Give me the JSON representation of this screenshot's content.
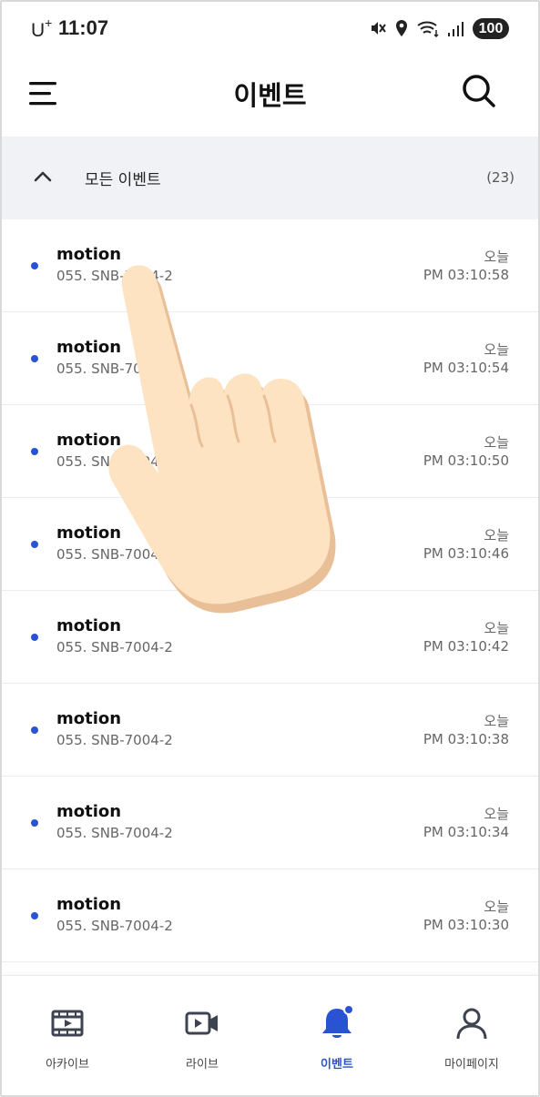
{
  "status_bar": {
    "carrier": "U",
    "carrier_sup": "+",
    "time": "11:07",
    "battery": "100"
  },
  "header": {
    "title": "이벤트",
    "menu_icon": "hamburger-menu-icon",
    "search_icon": "search-icon"
  },
  "group": {
    "title": "모든 이벤트",
    "count": "(23)"
  },
  "events": [
    {
      "title": "motion",
      "camera": "055. SNB-7004-2",
      "day": "오늘",
      "time": "PM 03:10:58"
    },
    {
      "title": "motion",
      "camera": "055. SNB-7004-2",
      "day": "오늘",
      "time": "PM 03:10:54"
    },
    {
      "title": "motion",
      "camera": "055. SNB-7004-2",
      "day": "오늘",
      "time": "PM 03:10:50"
    },
    {
      "title": "motion",
      "camera": "055. SNB-7004-2",
      "day": "오늘",
      "time": "PM 03:10:46"
    },
    {
      "title": "motion",
      "camera": "055. SNB-7004-2",
      "day": "오늘",
      "time": "PM 03:10:42"
    },
    {
      "title": "motion",
      "camera": "055. SNB-7004-2",
      "day": "오늘",
      "time": "PM 03:10:38"
    },
    {
      "title": "motion",
      "camera": "055. SNB-7004-2",
      "day": "오늘",
      "time": "PM 03:10:34"
    },
    {
      "title": "motion",
      "camera": "055. SNB-7004-2",
      "day": "오늘",
      "time": "PM 03:10:30"
    }
  ],
  "nav": {
    "archive": "아카이브",
    "live": "라이브",
    "events": "이벤트",
    "mypage": "마이페이지"
  },
  "colors": {
    "accent": "#2a53d3",
    "group_bg": "#f1f2f5",
    "hand": "#fde3c1"
  }
}
